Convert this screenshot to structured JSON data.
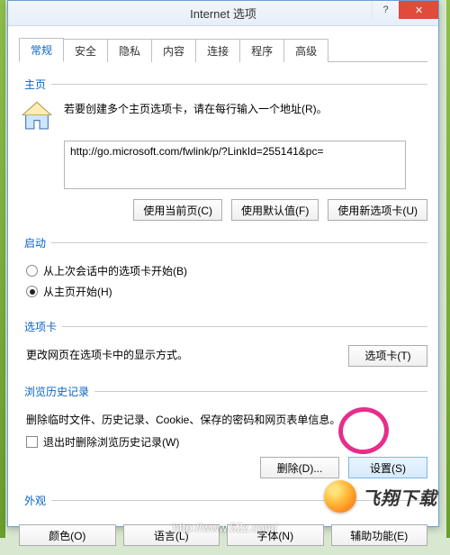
{
  "window": {
    "title": "Internet 选项",
    "help_symbol": "?",
    "close_symbol": "✕"
  },
  "tabs": [
    "常规",
    "安全",
    "隐私",
    "内容",
    "连接",
    "程序",
    "高级"
  ],
  "active_tab_index": 0,
  "homepage": {
    "legend": "主页",
    "instruction": "若要创建多个主页选项卡，请在每行输入一个地址(R)。",
    "value": "http://go.microsoft.com/fwlink/p/?LinkId=255141&pc=",
    "btn_current": "使用当前页(C)",
    "btn_default": "使用默认值(F)",
    "btn_newtab": "使用新选项卡(U)"
  },
  "startup": {
    "legend": "启动",
    "opt_last": "从上次会话中的选项卡开始(B)",
    "opt_home": "从主页开始(H)",
    "selected": "home"
  },
  "tabs_section": {
    "legend": "选项卡",
    "desc": "更改网页在选项卡中的显示方式。",
    "btn": "选项卡(T)"
  },
  "history": {
    "legend": "浏览历史记录",
    "desc": "删除临时文件、历史记录、Cookie、保存的密码和网页表单信息。",
    "check_label": "退出时删除浏览历史记录(W)",
    "checked": false,
    "btn_delete": "删除(D)...",
    "btn_settings": "设置(S)"
  },
  "appearance": {
    "legend": "外观",
    "btn_color": "颜色(O)",
    "btn_lang": "语言(L)",
    "btn_font": "字体(N)",
    "btn_access": "辅助功能(E)"
  },
  "watermark": {
    "brand": "飞翔下载",
    "url": "http://www.52z.com/"
  }
}
